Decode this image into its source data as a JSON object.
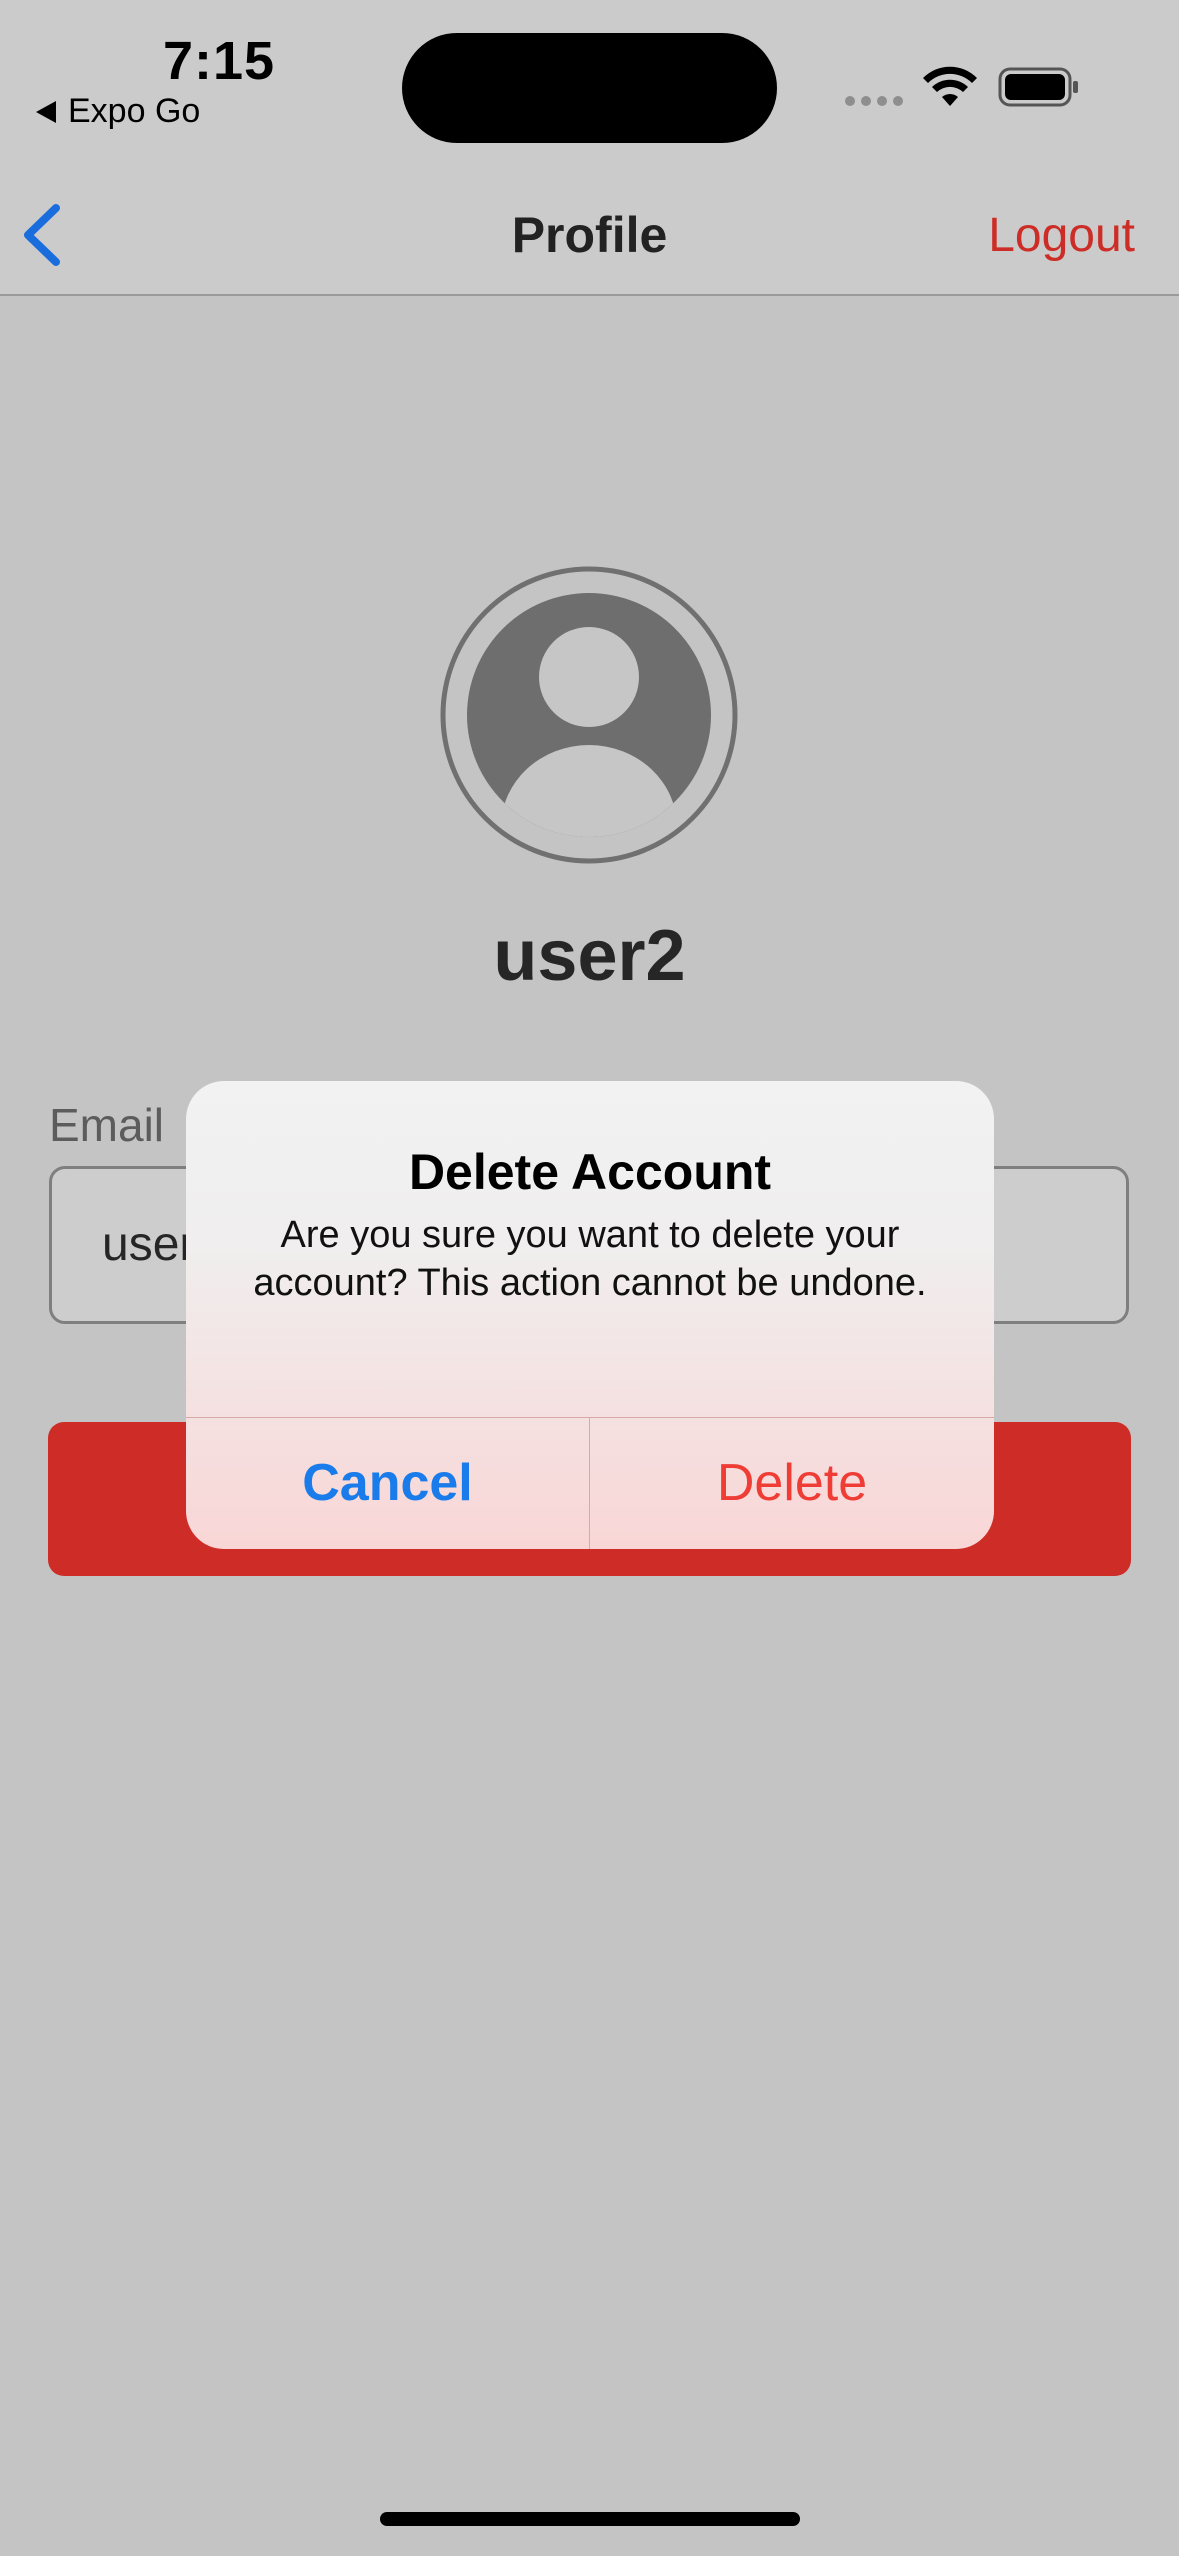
{
  "status_bar": {
    "time": "7:15",
    "back_app_label": "Expo Go",
    "icons": [
      "signal-icon",
      "wifi-icon",
      "battery-icon"
    ]
  },
  "nav": {
    "title": "Profile",
    "logout_label": "Logout",
    "back_icon": "chevron-left-icon"
  },
  "profile": {
    "avatar_icon": "user-avatar-icon",
    "username": "user2",
    "email_label": "Email",
    "email_value": "user"
  },
  "dialog": {
    "title": "Delete Account",
    "message": "Are you sure you want to delete your account? This action cannot be undone.",
    "cancel_label": "Cancel",
    "delete_label": "Delete"
  },
  "colors": {
    "accent_blue": "#1a7bea",
    "danger_red": "#cd2d26",
    "dialog_delete_red": "#ef3d35",
    "overlay_bg": "#c4c4c4"
  }
}
